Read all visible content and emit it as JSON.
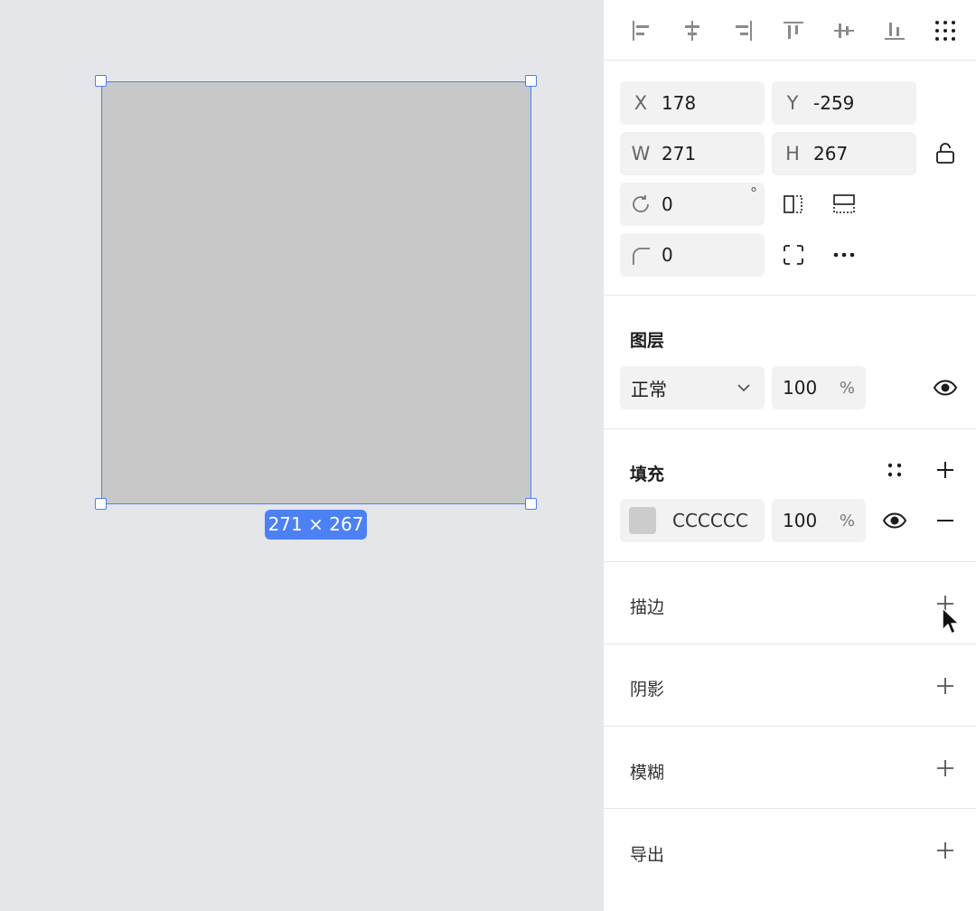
{
  "canvas": {
    "shape_fill": "#C8C8C8",
    "selection_color": "#4C80F5",
    "size_badge": "271 × 267"
  },
  "align": {
    "icons": [
      "align-left-icon",
      "align-h-center-icon",
      "align-right-icon",
      "align-top-icon",
      "align-v-center-icon",
      "align-bottom-icon",
      "distribute-grid-icon"
    ]
  },
  "transform": {
    "x_label": "X",
    "x_value": "178",
    "y_label": "Y",
    "y_value": "-259",
    "w_label": "W",
    "w_value": "271",
    "h_label": "H",
    "h_value": "267",
    "rotation_value": "0",
    "rotation_unit": "°",
    "radius_value": "0"
  },
  "layer": {
    "title": "图层",
    "blend_mode": "正常",
    "opacity": "100",
    "opacity_unit": "%"
  },
  "fill": {
    "title": "填充",
    "hex": "CCCCCC",
    "swatch": "#CCCCCC",
    "opacity": "100",
    "opacity_unit": "%"
  },
  "sections": {
    "stroke": "描边",
    "shadow": "阴影",
    "blur": "模糊",
    "export": "导出"
  }
}
